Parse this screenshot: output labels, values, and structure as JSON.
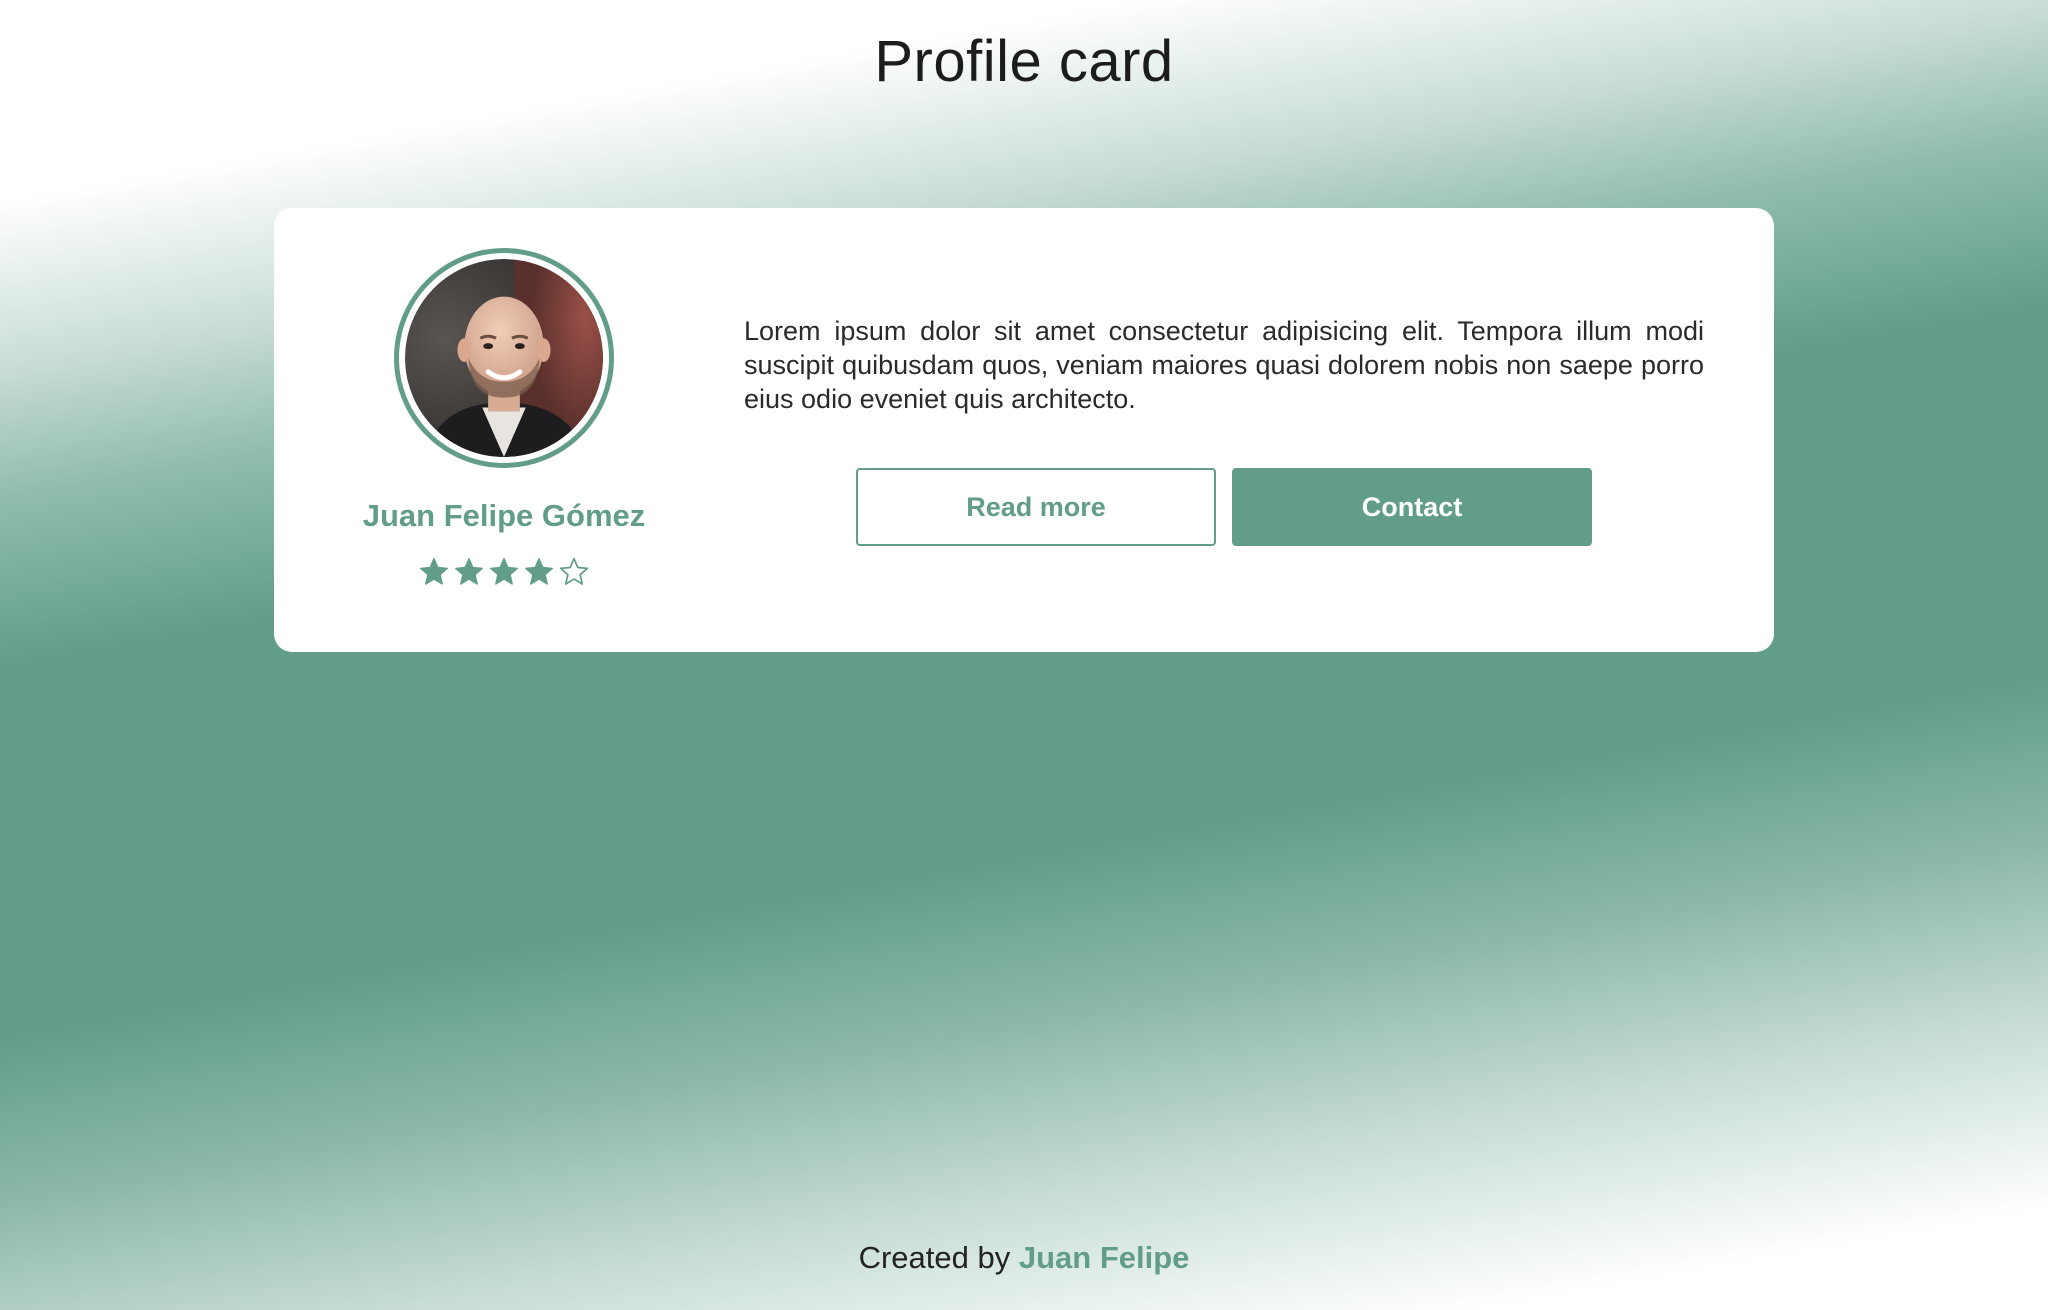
{
  "page": {
    "title": "Profile card"
  },
  "profile": {
    "name": "Juan Felipe Gómez",
    "rating": 4,
    "rating_max": 5,
    "bio": "Lorem ipsum dolor sit amet consectetur adipisicing elit. Tempora illum modi suscipit quibusdam quos, veniam maiores quasi dolorem nobis non saepe porro eius odio eveniet quis architecto."
  },
  "actions": {
    "read_more_label": "Read more",
    "contact_label": "Contact"
  },
  "footer": {
    "prefix": "Created by",
    "author": "Juan Felipe"
  },
  "colors": {
    "accent": "#629d8a",
    "card": "#ffffff",
    "text": "#222222"
  }
}
